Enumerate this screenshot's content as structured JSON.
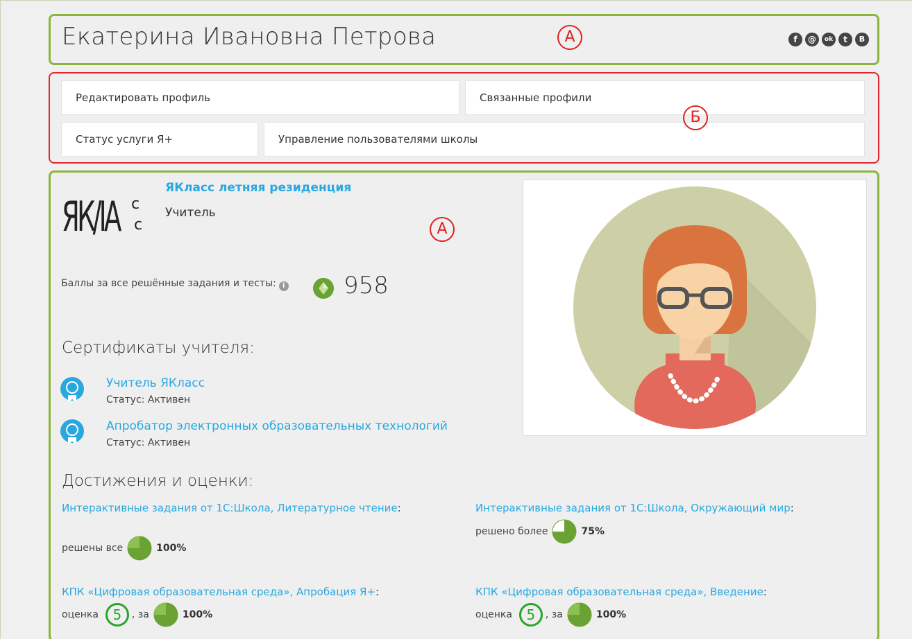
{
  "header": {
    "user_name": "Екатерина Ивановна Петрова",
    "marker": "А",
    "social_icons": [
      "facebook-icon",
      "mailru-icon",
      "odnoklassniki-icon",
      "twitter-icon",
      "vkontakte-icon"
    ],
    "social_glyphs": [
      "f",
      "@",
      "ok",
      "t",
      "B"
    ]
  },
  "menu": {
    "edit_profile": "Редактировать профиль",
    "linked_profiles": "Связанные профили",
    "service_status": "Статус услуги Я+",
    "school_users": "Управление пользователями школы",
    "marker": "Б"
  },
  "main": {
    "marker": "А",
    "school_name": "ЯКласс летняя резиденция",
    "role": "Учитель",
    "points_label": "Баллы за все решённые задания и тесты:",
    "points_value": "958",
    "certificates_title": "Сертификаты учителя:",
    "certificates": [
      {
        "title": "Учитель ЯКласс",
        "status": "Статус: Активен"
      },
      {
        "title": "Апробатор электронных образовательных технологий",
        "status": "Статус: Активен"
      }
    ],
    "achievements_title": "Достижения и оценки:",
    "achievements": [
      {
        "link": "Интерактивные задания от 1С:Школа, Литературное чтение",
        "prefix": "решены все",
        "percent": "100%",
        "fraction": 1.0
      },
      {
        "link": "Интерактивные задания от 1С:Школа, Окружающий мир",
        "prefix": "решено более",
        "percent": "75%",
        "fraction": 0.75
      },
      {
        "link": "КПК «Цифровая образовательная среда», Апробация Я+",
        "prefix": "оценка",
        "grade": "5",
        "mid": ", за",
        "percent": "100%",
        "fraction": 1.0
      },
      {
        "link": "КПК «Цифровая образовательная среда», Введение",
        "prefix": "оценка",
        "grade": "5",
        "mid": ", за",
        "percent": "100%",
        "fraction": 1.0
      }
    ]
  },
  "colors": {
    "green_border": "#8ab43c",
    "red_border": "#e0262c",
    "link_blue": "#29a8e0",
    "grade_green": "#28a628"
  }
}
